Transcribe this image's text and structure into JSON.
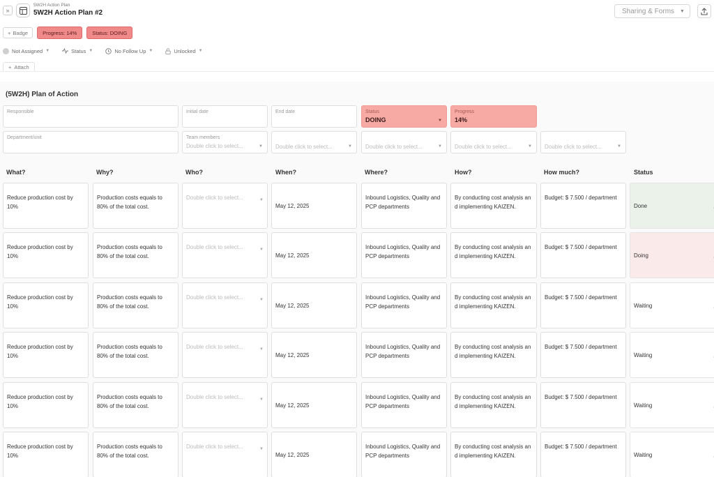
{
  "header": {
    "breadcrumb": "5W2H Action Plan",
    "title": "5W2H Action Plan #2",
    "share_label": "Sharing & Forms"
  },
  "badges": {
    "add_label": "Badge",
    "progress_badge": "Progress: 14%",
    "status_badge": "Status: DOING"
  },
  "meta": {
    "assigned": "Not Assigned",
    "status": "Status",
    "follow_up": "No Follow Up",
    "lock": "Unlocked",
    "attach": "Attach"
  },
  "section": {
    "title": "(5W2H) Plan of Action"
  },
  "form": {
    "responsible_label": "Responsible",
    "initial_date_label": "Initial date",
    "end_date_label": "End date",
    "status_label": "Status",
    "status_value": "DOING",
    "progress_label": "Progress",
    "progress_value": "14%",
    "department_label": "Department/unit",
    "team_label": "Team members",
    "select_placeholder": "Double click to select..."
  },
  "table": {
    "headers": [
      "What?",
      "Why?",
      "Who?",
      "When?",
      "Where?",
      "How?",
      "How much?",
      "Status"
    ],
    "rows": [
      {
        "what": "Reduce production cost by 10%",
        "why": "Production costs equals to 80% of the total cost.",
        "who": "Double click to select...",
        "when": "May 12, 2025",
        "where": "Inbound Logistics, Quality and PCP departments",
        "how": "By conducting cost analysis and implementing KAIZEN.",
        "how_much": "Budget: $ 7.500 / department",
        "status": "Done"
      },
      {
        "what": "Reduce production cost by 10%",
        "why": "Production costs equals to 80% of the total cost.",
        "who": "Double click to select...",
        "when": "May 12, 2025",
        "where": "Inbound Logistics, Quality and PCP departments",
        "how": "By conducting cost analysis and implementing KAIZEN.",
        "how_much": "Budget: $ 7.500 / department",
        "status": "Doing"
      },
      {
        "what": "Reduce production cost by 10%",
        "why": "Production costs equals to 80% of the total cost.",
        "who": "Double click to select...",
        "when": "May 12, 2025",
        "where": "Inbound Logistics, Quality and PCP departments",
        "how": "By conducting cost analysis and implementing KAIZEN.",
        "how_much": "Budget: $ 7.500 / department",
        "status": "Waiting"
      },
      {
        "what": "Reduce production cost by 10%",
        "why": "Production costs equals to 80% of the total cost.",
        "who": "Double click to select...",
        "when": "May 12, 2025",
        "where": "Inbound Logistics, Quality and PCP departments",
        "how": "By conducting cost analysis and implementing KAIZEN.",
        "how_much": "Budget: $ 7.500 / department",
        "status": "Waiting"
      },
      {
        "what": "Reduce production cost by 10%",
        "why": "Production costs equals to 80% of the total cost.",
        "who": "Double click to select...",
        "when": "May 12, 2025",
        "where": "Inbound Logistics, Quality and PCP departments",
        "how": "By conducting cost analysis and implementing KAIZEN.",
        "how_much": "Budget: $ 7.500 / department",
        "status": "Waiting"
      },
      {
        "what": "Reduce production cost by 10%",
        "why": "Production costs equals to 80% of the total cost.",
        "who": "Double click to select...",
        "when": "May 12, 2025",
        "where": "Inbound Logistics, Quality and PCP departments",
        "how": "By conducting cost analysis and implementing KAIZEN.",
        "how_much": "Budget: $ 7.500 / department",
        "status": "Waiting"
      }
    ]
  },
  "colors": {
    "badge_red": "#f08a8a",
    "field_red": "#f7a9a3",
    "status_done_bg": "#eaf2ea",
    "status_doing_bg": "#fbeaea"
  },
  "icons": {
    "collapse": "double-chevron-right-icon",
    "document": "table-layout-icon",
    "upload": "share-arrow-icon",
    "plus": "plus-icon",
    "activity": "activity-icon",
    "clock": "clock-icon",
    "lock": "lock-icon"
  }
}
